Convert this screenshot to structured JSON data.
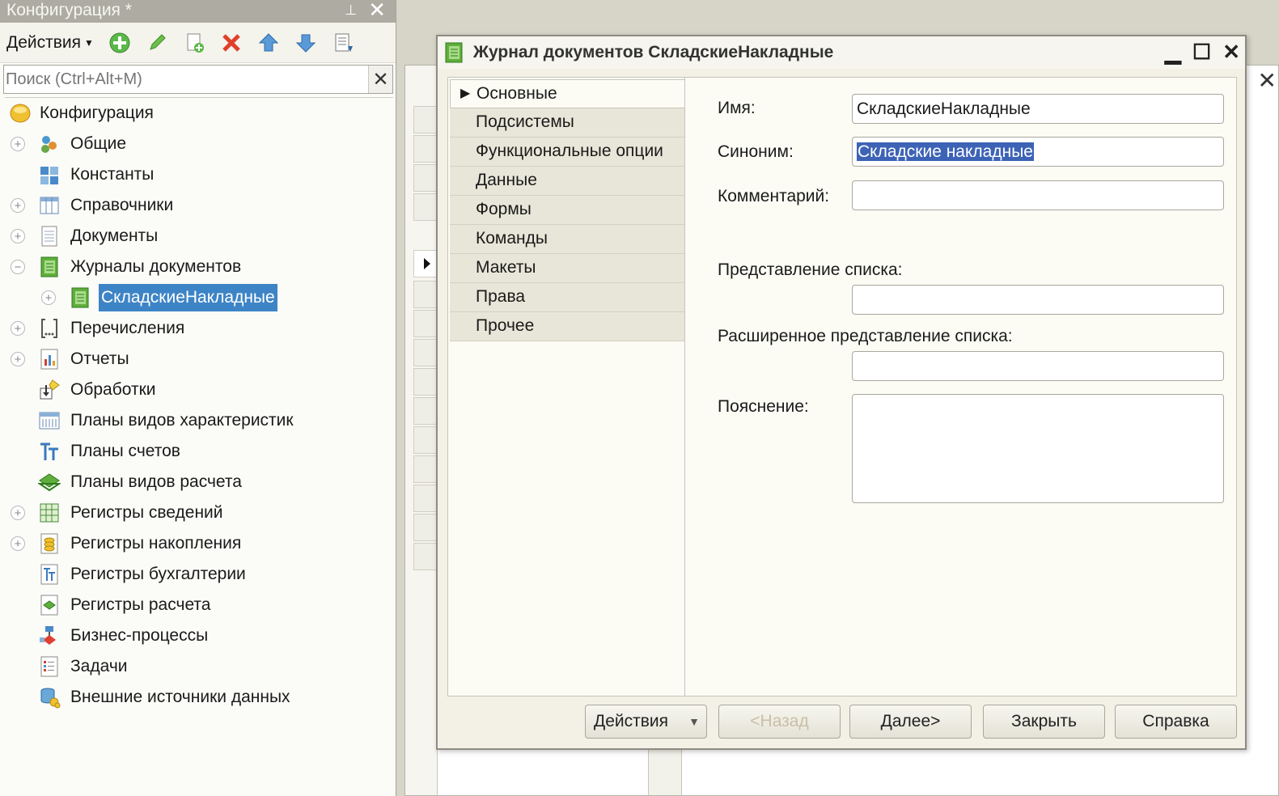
{
  "left_panel": {
    "title": "Конфигурация *",
    "pin_icon": "⮤",
    "toolbar": {
      "actions_label": "Действия"
    },
    "search_placeholder": "Поиск (Ctrl+Alt+M)",
    "tree": [
      {
        "label": "Конфигурация",
        "icon": "config-icon"
      },
      {
        "label": "Общие",
        "icon": "common-icon"
      },
      {
        "label": "Константы",
        "icon": "constants-icon"
      },
      {
        "label": "Справочники",
        "icon": "catalogs-icon"
      },
      {
        "label": "Документы",
        "icon": "documents-icon"
      },
      {
        "label": "Журналы документов",
        "icon": "journal-icon"
      },
      {
        "label": "СкладскиеНакладные",
        "icon": "journal-icon"
      },
      {
        "label": "Перечисления",
        "icon": "enums-icon"
      },
      {
        "label": "Отчеты",
        "icon": "reports-icon"
      },
      {
        "label": "Обработки",
        "icon": "processing-icon"
      },
      {
        "label": "Планы видов характеристик",
        "icon": "chart-of-char-icon"
      },
      {
        "label": "Планы счетов",
        "icon": "chart-of-accounts-icon"
      },
      {
        "label": "Планы видов расчета",
        "icon": "chart-of-calc-icon"
      },
      {
        "label": "Регистры сведений",
        "icon": "info-register-icon"
      },
      {
        "label": "Регистры накопления",
        "icon": "accum-register-icon"
      },
      {
        "label": "Регистры бухгалтерии",
        "icon": "accounting-register-icon"
      },
      {
        "label": "Регистры расчета",
        "icon": "calc-register-icon"
      },
      {
        "label": "Бизнес-процессы",
        "icon": "business-process-icon"
      },
      {
        "label": "Задачи",
        "icon": "tasks-icon"
      },
      {
        "label": "Внешние источники данных",
        "icon": "external-data-icon"
      }
    ]
  },
  "dialog": {
    "title": "Журнал документов СкладскиеНакладные",
    "nav": [
      "Основные",
      "Подсистемы",
      "Функциональные опции",
      "Данные",
      "Формы",
      "Команды",
      "Макеты",
      "Права",
      "Прочее"
    ],
    "fields": {
      "name_label": "Имя:",
      "name_value": "СкладскиеНакладные",
      "synonym_label": "Синоним:",
      "synonym_value": "Складские накладные",
      "comment_label": "Комментарий:",
      "comment_value": "",
      "list_presentation_label": "Представление списка:",
      "list_presentation_value": "",
      "ext_list_presentation_label": "Расширенное представление списка:",
      "ext_list_presentation_value": "",
      "explanation_label": "Пояснение:"
    },
    "buttons": {
      "actions": "Действия",
      "back": "<Назад",
      "next": "Далее>",
      "close": "Закрыть",
      "help": "Справка"
    }
  }
}
